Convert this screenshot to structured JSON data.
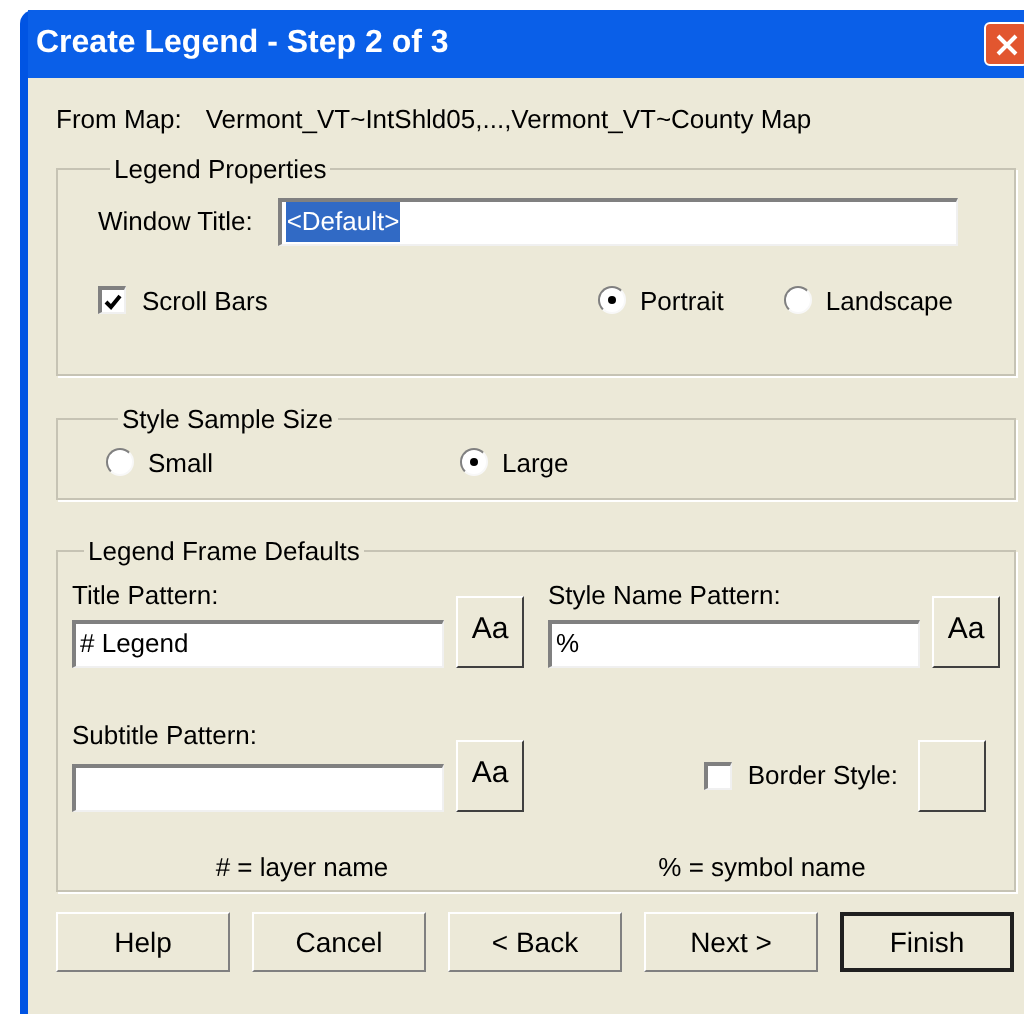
{
  "window": {
    "title": "Create Legend - Step 2 of 3"
  },
  "from_map": {
    "label": "From Map:",
    "value": "Vermont_VT~IntShld05,...,Vermont_VT~County Map"
  },
  "legend_properties": {
    "title": "Legend Properties",
    "window_title": {
      "label": "Window Title:",
      "value": "<Default>",
      "highlighted": true
    },
    "scroll_bars": {
      "label": "Scroll Bars",
      "checked": true
    },
    "orientation": [
      {
        "label": "Portrait",
        "selected": true
      },
      {
        "label": "Landscape",
        "selected": false
      }
    ]
  },
  "style_sample_size": {
    "title": "Style Sample Size",
    "options": [
      {
        "label": "Small",
        "selected": false
      },
      {
        "label": "Large",
        "selected": true
      }
    ]
  },
  "legend_frame_defaults": {
    "title": "Legend Frame Defaults",
    "title_pattern": {
      "label": "Title Pattern:",
      "value": "# Legend",
      "font_button": "Aa"
    },
    "style_name_pattern": {
      "label": "Style Name Pattern:",
      "value": "%",
      "font_button": "Aa"
    },
    "subtitle_pattern": {
      "label": "Subtitle Pattern:",
      "font_button": "Aa"
    },
    "border_style": {
      "label": "Border Style:",
      "checked": false
    },
    "hints": [
      "# = layer name",
      "% = symbol name"
    ]
  },
  "buttons": [
    {
      "label": "Help",
      "default": false
    },
    {
      "label": "Cancel",
      "default": false
    },
    {
      "label": "< Back",
      "default": false
    },
    {
      "label": "Next >",
      "default": false
    },
    {
      "label": "Finish",
      "default": true
    }
  ]
}
